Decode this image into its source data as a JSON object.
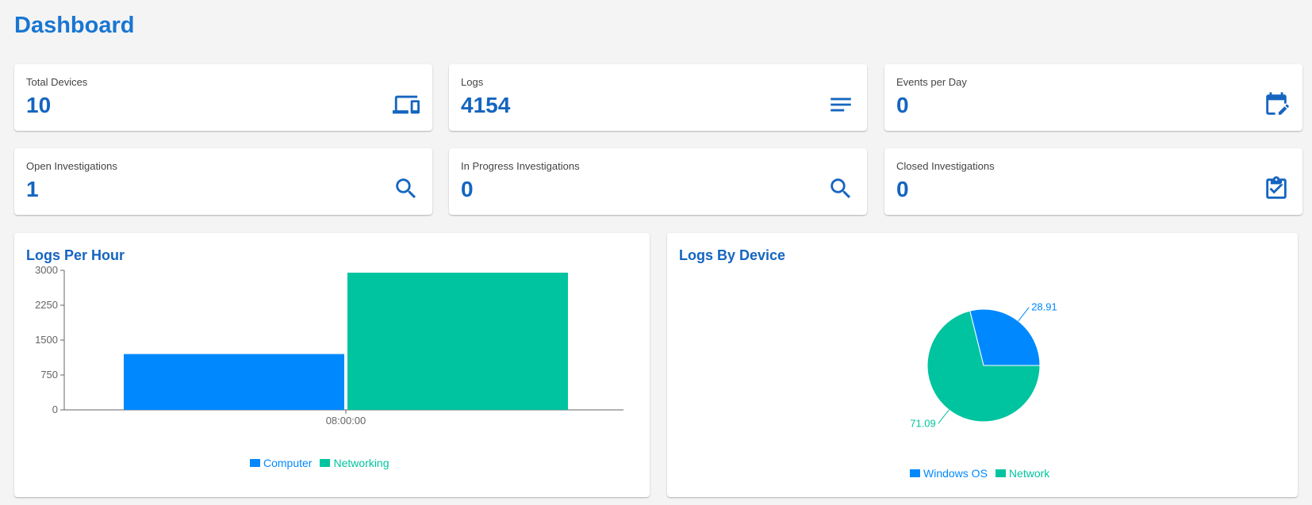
{
  "page": {
    "title": "Dashboard"
  },
  "stats": [
    {
      "label": "Total Devices",
      "value": "10",
      "icon": "devices-icon"
    },
    {
      "label": "Logs",
      "value": "4154",
      "icon": "list-icon"
    },
    {
      "label": "Events per Day",
      "value": "0",
      "icon": "calendar-edit-icon"
    },
    {
      "label": "Open Investigations",
      "value": "1",
      "icon": "search-icon"
    },
    {
      "label": "In Progress Investigations",
      "value": "0",
      "icon": "search-icon"
    },
    {
      "label": "Closed Investigations",
      "value": "0",
      "icon": "clipboard-check-icon"
    }
  ],
  "colors": {
    "accent": "#1565c0",
    "computer": "#0088fe",
    "networking": "#00c49f"
  },
  "charts": {
    "logs_per_hour": {
      "title": "Logs Per Hour"
    },
    "logs_by_device": {
      "title": "Logs By Device"
    }
  },
  "chart_data": [
    {
      "type": "bar",
      "title": "Logs Per Hour",
      "categories": [
        "08:00:00"
      ],
      "series": [
        {
          "name": "Computer",
          "values": [
            1200
          ],
          "color": "#0088fe"
        },
        {
          "name": "Networking",
          "values": [
            2950
          ],
          "color": "#00c49f"
        }
      ],
      "ylim": [
        0,
        3000
      ],
      "yticks": [
        "0",
        "750",
        "1500",
        "2250",
        "3000"
      ],
      "grid": false,
      "legend": "bottom"
    },
    {
      "type": "pie",
      "title": "Logs By Device",
      "slices": [
        {
          "name": "Windows OS",
          "value": 28.91,
          "label": "28.91",
          "color": "#0088fe"
        },
        {
          "name": "Network",
          "value": 71.09,
          "label": "71.09",
          "color": "#00c49f"
        }
      ],
      "legend": "bottom"
    }
  ]
}
